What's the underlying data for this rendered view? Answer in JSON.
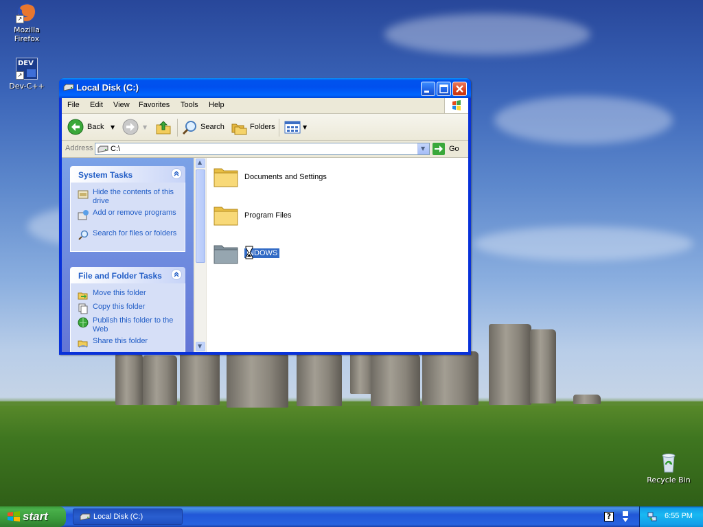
{
  "desktop": {
    "icons": [
      {
        "label": "Mozilla Firefox",
        "icon": "firefox-icon"
      },
      {
        "label": "Dev-C++",
        "icon": "dev-cpp-icon",
        "badge": "DEV"
      },
      {
        "label": "Recycle Bin",
        "icon": "recycle-bin-icon"
      }
    ]
  },
  "window": {
    "title": "Local Disk (C:)",
    "menu": [
      "File",
      "Edit",
      "View",
      "Favorites",
      "Tools",
      "Help"
    ],
    "toolbar": {
      "back_label": "Back",
      "search_label": "Search",
      "folders_label": "Folders"
    },
    "address": {
      "label": "Address",
      "value": "C:\\",
      "go_label": "Go"
    },
    "system_tasks": {
      "title": "System Tasks",
      "items": [
        {
          "label": "Hide the contents of this drive",
          "icon": "hide-contents-icon"
        },
        {
          "label": "Add or remove programs",
          "icon": "add-remove-programs-icon"
        },
        {
          "label": "Search for files or folders",
          "icon": "search-icon"
        }
      ]
    },
    "file_folder_tasks": {
      "title": "File and Folder Tasks",
      "items": [
        {
          "label": "Move this folder",
          "icon": "move-folder-icon"
        },
        {
          "label": "Copy this folder",
          "icon": "copy-folder-icon"
        },
        {
          "label": "Publish this folder to the Web",
          "icon": "publish-web-icon"
        },
        {
          "label": "Share this folder",
          "icon": "share-folder-icon"
        }
      ]
    },
    "files": [
      {
        "name": "Documents and Settings",
        "icon": "folder-icon"
      },
      {
        "name": "Program Files",
        "icon": "folder-icon"
      },
      {
        "name": "INDOWS",
        "icon": "folder-icon",
        "state": "renaming",
        "cursor": "hourglass-icon"
      }
    ]
  },
  "taskbar": {
    "start_label": "start",
    "tasks": [
      {
        "label": "Local Disk (C:)",
        "icon": "drive-icon"
      }
    ],
    "clock": "6:55 PM"
  },
  "colors": {
    "titlebar": "#0054e3",
    "start": "#3a9b3b",
    "link": "#215dc6",
    "selection": "#316ac5"
  }
}
